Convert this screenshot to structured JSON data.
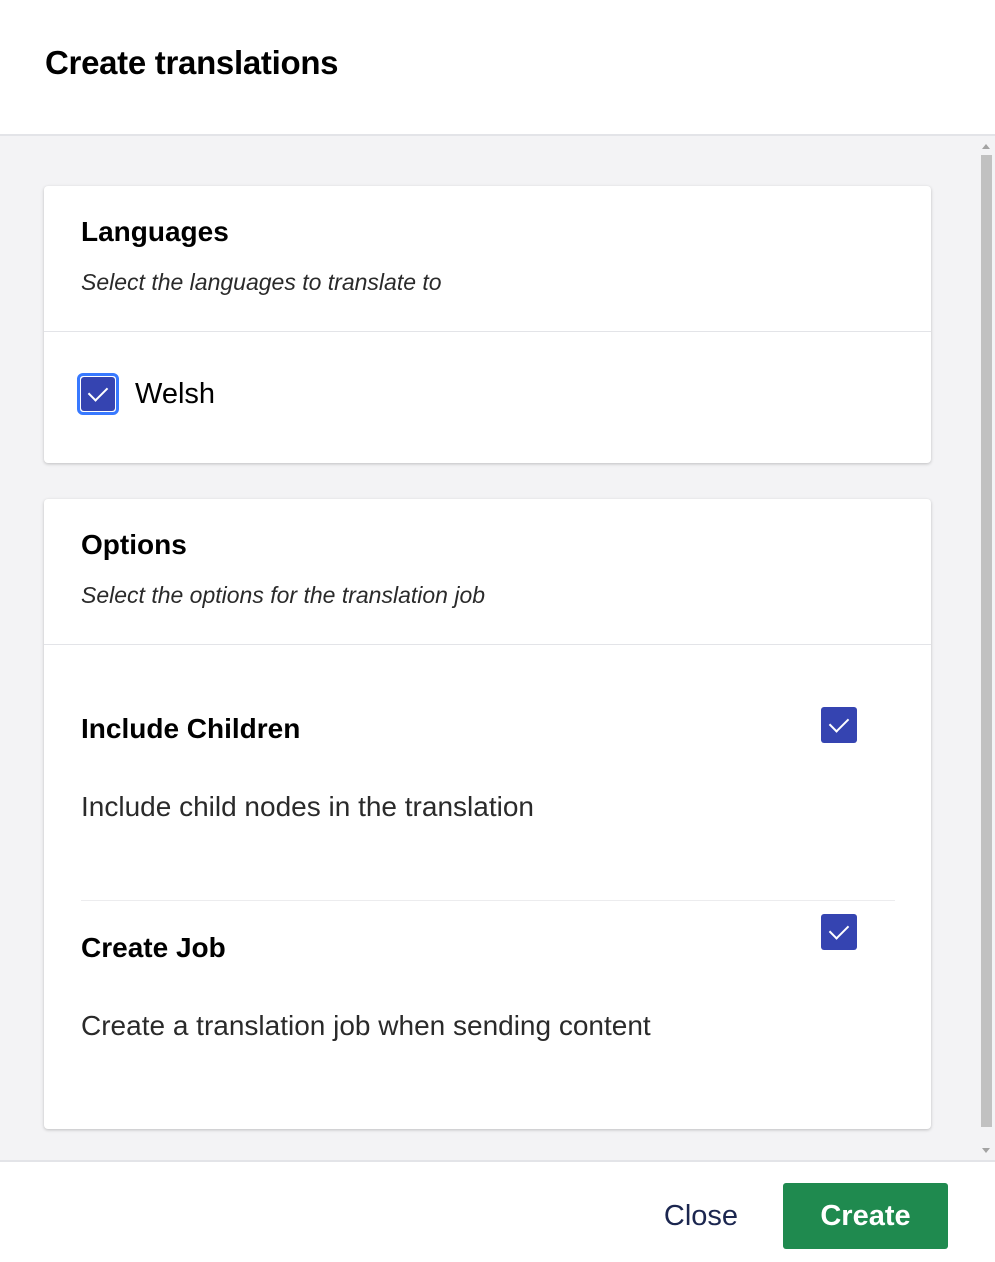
{
  "dialog": {
    "title": "Create translations"
  },
  "languages": {
    "title": "Languages",
    "subtitle": "Select the languages to translate to",
    "items": [
      {
        "label": "Welsh",
        "checked": true
      }
    ]
  },
  "options": {
    "title": "Options",
    "subtitle": "Select the options for the translation job",
    "items": [
      {
        "title": "Include Children",
        "description": "Include child nodes in the translation",
        "checked": true
      },
      {
        "title": "Create Job",
        "description": "Create a translation job when sending content",
        "checked": true
      }
    ]
  },
  "footer": {
    "close_label": "Close",
    "create_label": "Create"
  },
  "colors": {
    "checkbox": "#3544b1",
    "focus_ring": "#3879ff",
    "create_button": "#1f8a4f",
    "body_background": "#f3f3f5"
  },
  "icons": {
    "checkbox_check": "check-icon"
  }
}
